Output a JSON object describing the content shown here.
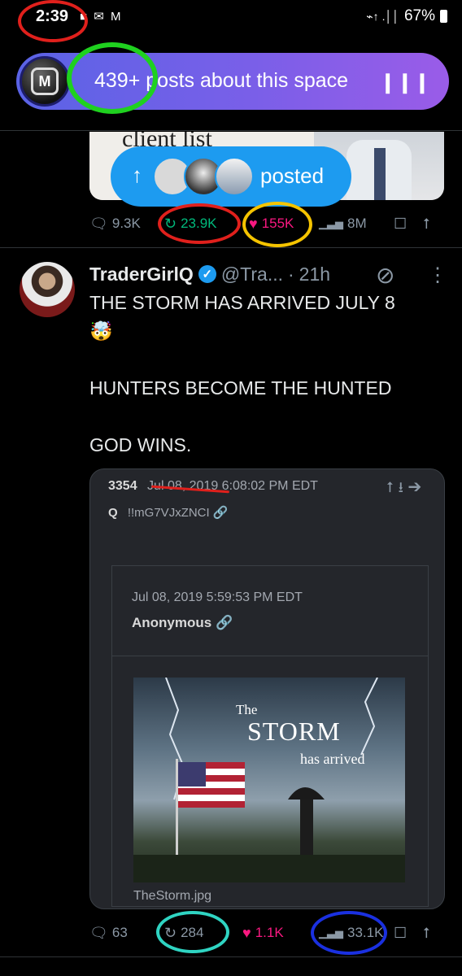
{
  "status_bar": {
    "time": "2:39",
    "left_icons": "■ ✉ M",
    "right_icons": "⌁↑ .││",
    "battery": "67%"
  },
  "space_banner": {
    "avatar_letters": "M",
    "label": "439+ posts about this space",
    "bars_icon": "❙❙❙"
  },
  "prev_media": {
    "crop_text": "client list"
  },
  "posted_pill": {
    "arrow": "↑",
    "label": "posted"
  },
  "prev_actions": {
    "replies": "9.3K",
    "reposts": "23.9K",
    "likes": "155K",
    "views": "8M"
  },
  "tweet": {
    "name": "TraderGirlQ",
    "verified_mark": "✓",
    "handle": "@Tra...",
    "separator": "·",
    "time": "21h",
    "lines": [
      "THE STORM HAS ARRIVED JULY 8",
      "🤯",
      "",
      "HUNTERS BECOME THE HUNTED",
      "",
      "GOD WINS."
    ],
    "card": {
      "post_number": "3354",
      "post_date": "Jul 08, 2019 6:08:02 PM EDT",
      "author": "Q",
      "tripcode": "!!mG7VJxZNCI",
      "inner_date": "Jul 08, 2019 5:59:53 PM EDT",
      "inner_author": "Anonymous",
      "image_text_1": "The",
      "image_text_2": "STORM",
      "image_text_3": "has arrived",
      "filename": "TheStorm.jpg"
    },
    "actions": {
      "replies": "63",
      "reposts": "284",
      "likes": "1.1K",
      "views": "33.1K"
    }
  },
  "icons": {
    "reply": "reply-icon",
    "repost": "repost-icon",
    "like": "heart-icon",
    "views": "views-icon",
    "bookmark": "bookmark-icon",
    "share": "share-icon"
  },
  "colors": {
    "accent": "#1d9bf0",
    "repost": "#00ba7c",
    "like": "#f91880",
    "background": "#000000"
  }
}
